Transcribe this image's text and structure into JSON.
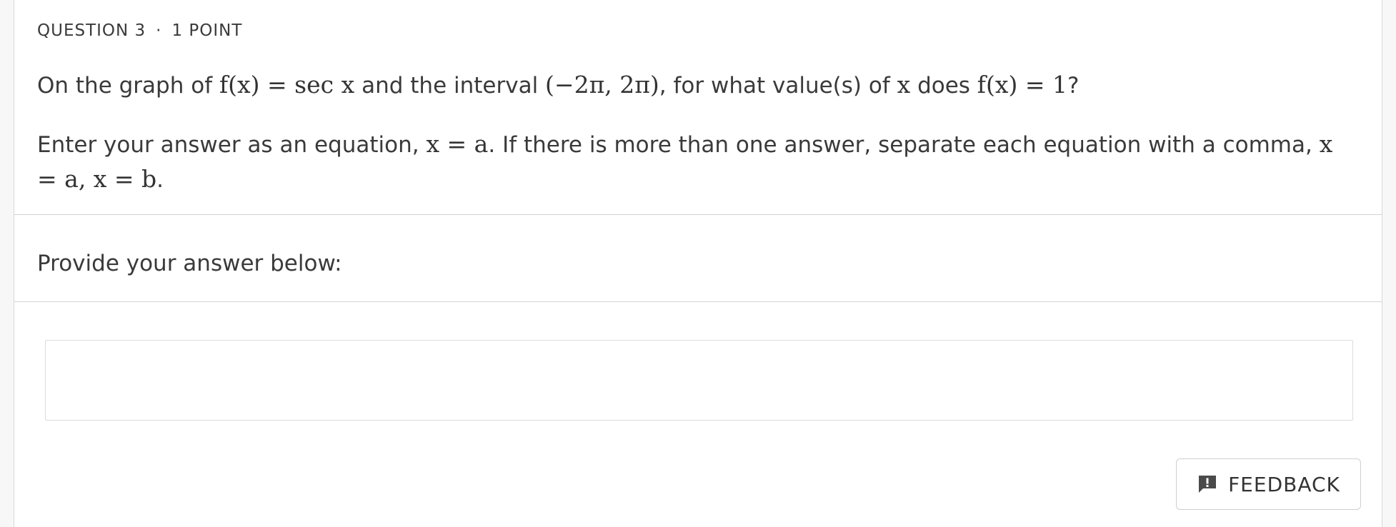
{
  "question": {
    "number_label": "QUESTION 3",
    "separator": "·",
    "points_label": "1 POINT"
  },
  "prompt_text": {
    "part1": "On the graph of ",
    "math1": "f(x) = sec x",
    "part2": " and the interval ",
    "math2": "(−2π, 2π)",
    "part3": ", for what value(s) of ",
    "math3": "x",
    "part4": " does ",
    "math4": "f(x) = 1",
    "part5": "?"
  },
  "instructions": {
    "part1": "Enter your answer as an equation, ",
    "math1": "x = a",
    "part2": ". If there is more than one answer, separate each equation with a comma, ",
    "math2": "x = a, x = b",
    "part3": "."
  },
  "answer_section": {
    "label": "Provide your answer below:",
    "input_value": "",
    "input_placeholder": ""
  },
  "feedback_button": {
    "label": "FEEDBACK",
    "icon": "feedback-icon"
  }
}
